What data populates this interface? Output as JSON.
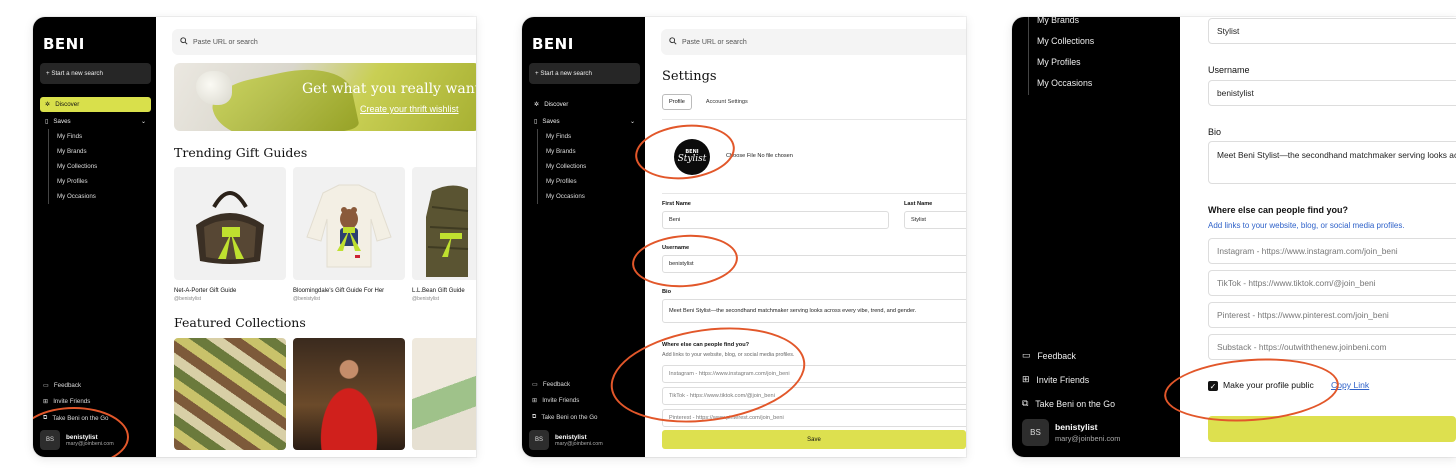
{
  "brand": {
    "logo": "BENI"
  },
  "sidebar": {
    "new_search": "+ Start a new search",
    "discover": "Discover",
    "saves": "Saves",
    "saves_items": [
      "My Finds",
      "My Brands",
      "My Collections",
      "My Profiles",
      "My Occasions"
    ],
    "feedback": "Feedback",
    "invite": "Invite Friends",
    "take_beni": "Take Beni on the Go",
    "avatar_initials": "BS",
    "username": "benistylist",
    "email": "mary@joinbeni.com"
  },
  "search": {
    "placeholder": "Paste URL or search"
  },
  "discover_page": {
    "hero_title": "Get what you really want this",
    "hero_link": "Create your thrift wishlist",
    "trending_title": "Trending Gift Guides",
    "featured_title": "Featured Collections",
    "guides": [
      {
        "title": "Net-A-Porter Gift Guide",
        "handle": "@benistylist"
      },
      {
        "title": "Bloomingdale's Gift Guide For Her",
        "handle": "@benistylist"
      },
      {
        "title": "L.L.Bean Gift Guide",
        "handle": "@benistylist"
      }
    ]
  },
  "settings_page": {
    "title": "Settings",
    "tab_profile": "Profile",
    "tab_account": "Account Settings",
    "photo_line1": "BENI",
    "photo_line2": "Stylist",
    "choose_file": "Choose File  No file chosen",
    "first_name_label": "First Name",
    "first_name": "Beni",
    "last_name_label": "Last Name",
    "last_name": "Stylist",
    "username_label": "Username",
    "username": "benistylist",
    "bio_label": "Bio",
    "bio": "Meet Beni Stylist—the secondhand matchmaker serving looks across every vibe, trend, and gender.",
    "links_label": "Where else can people find you?",
    "links_helper": "Add links to your website, blog, or social media profiles.",
    "instagram": "Instagram - https://www.instagram.com/join_beni",
    "tiktok": "TikTok - https://www.tiktok.com/@join_beni",
    "pinterest": "Pinterest - https://www.pinterest.com/join_beni",
    "substack": "Substack - https://outwiththenew.joinbeni.com",
    "public_label": "Make your profile public",
    "copy_link": "Copy Link",
    "save": "Save"
  },
  "colors": {
    "accent": "#dde04f",
    "annotation": "#e2572a",
    "sidebar": "#000000"
  }
}
